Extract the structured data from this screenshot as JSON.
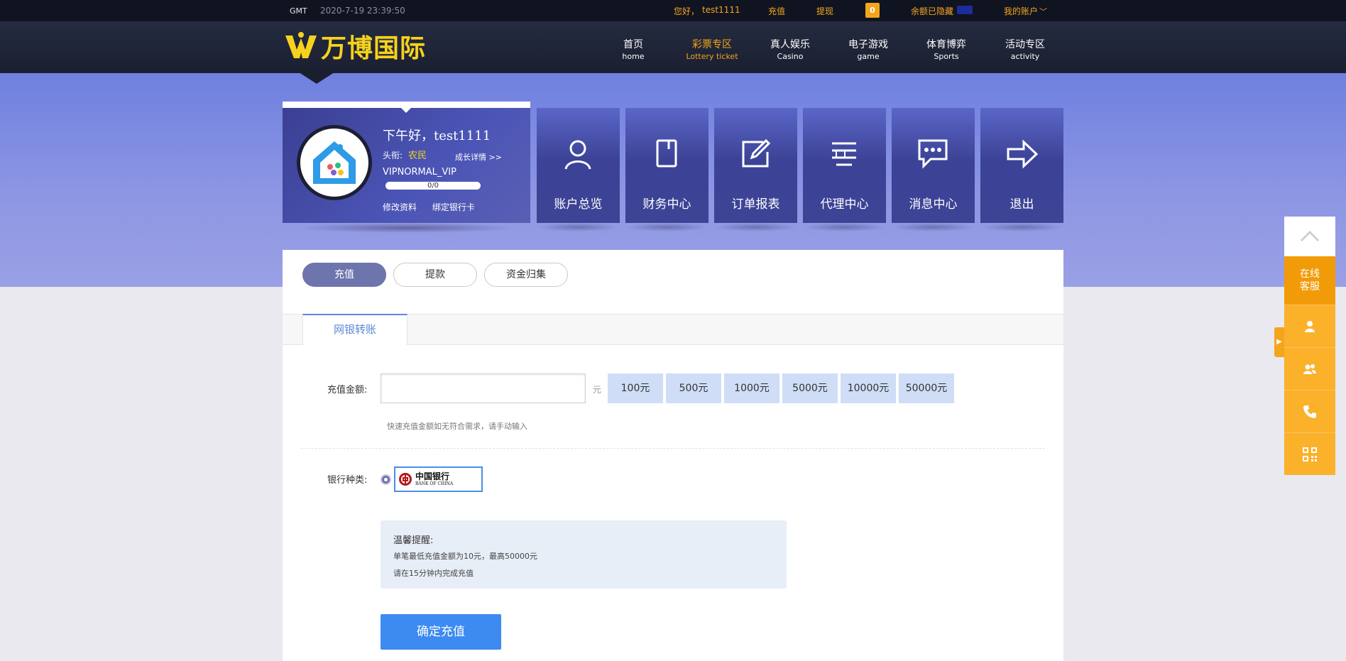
{
  "topbar": {
    "gmt": "GMT",
    "time": "2020-7-19 23:39:50",
    "greeting": "您好，",
    "username": "test1111",
    "deposit": "充值",
    "withdraw": "提现",
    "badge": "0",
    "balance_hidden": "余额已隐藏",
    "my_account": "我的账户"
  },
  "header": {
    "logo_text": "万博国际",
    "nav": [
      {
        "cn": "首页",
        "en": "home"
      },
      {
        "cn": "彩票专区",
        "en": "Lottery ticket"
      },
      {
        "cn": "真人娱乐",
        "en": "Casino"
      },
      {
        "cn": "电子游戏",
        "en": "game"
      },
      {
        "cn": "体育博弈",
        "en": "Sports"
      },
      {
        "cn": "活动专区",
        "en": "activity"
      }
    ]
  },
  "profile": {
    "greeting": "下午好，test1111",
    "title_label": "头衔:",
    "title_value": "农民",
    "growth_link": "成长详情 >>",
    "vip": "VIPNORMAL_VIP",
    "progress_text": "0/0",
    "progress": 0,
    "edit_profile": "修改资料",
    "bind_card": "绑定银行卡"
  },
  "tiles": [
    {
      "label": "账户总览",
      "icon": "user-icon"
    },
    {
      "label": "财务中心",
      "icon": "book-icon"
    },
    {
      "label": "订单报表",
      "icon": "edit-icon"
    },
    {
      "label": "代理中心",
      "icon": "list-icon"
    },
    {
      "label": "消息中心",
      "icon": "chat-icon"
    },
    {
      "label": "退出",
      "icon": "logout-arrow-icon"
    }
  ],
  "panel": {
    "pills": [
      "充值",
      "提款",
      "资金归集"
    ],
    "tab": "网银转账",
    "amount_label": "充值金额:",
    "amount_value": "",
    "unit": "元",
    "quick_amounts": [
      "100元",
      "500元",
      "1000元",
      "5000元",
      "10000元",
      "50000元"
    ],
    "hint": "快速充值金额如无符合需求，请手动输入",
    "bank_label": "银行种类:",
    "bank_cn": "中国银行",
    "bank_en": "BANK OF CHINA",
    "tip_title": "温馨提醒:",
    "tip_line1": "单笔最低充值金额为10元，最高50000元",
    "tip_line2": "请在15分钟内完成充值",
    "submit": "确定充值"
  },
  "side": {
    "customer_service_1": "在线",
    "customer_service_2": "客服"
  },
  "colors": {
    "accent_orange": "#f4a51c",
    "brand_yellow": "#f6d21d",
    "primary_blue": "#3d8af0",
    "tile_blue": "#3c4396"
  }
}
